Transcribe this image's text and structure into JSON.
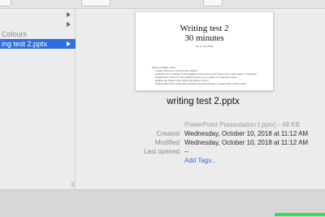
{
  "sidebar": {
    "rows": [
      {
        "label": "",
        "selected": false,
        "has_chevron": true
      },
      {
        "label": "",
        "selected": false,
        "has_chevron": true
      },
      {
        "label": "Colours",
        "selected": false,
        "has_chevron": false
      },
      {
        "label": "ing test 2.pptx",
        "selected": true,
        "has_chevron": true
      }
    ],
    "resize_handle_glyph": "||"
  },
  "preview": {
    "thumbnail": {
      "title_line1": "Writing test 2",
      "title_line2": "30 minutes",
      "date": "10-11 Oct 2018",
      "intro": "When you finish, check:",
      "bullets": [
        "Content: Have you covered all the content?",
        "Grammar and vocabulary: Is the grammar accurate and correct? Does it use a wide range of vocabulary?",
        "Organisation: Is the text well-organised? Does it use a variety of connecting words?",
        "Register and format: Is the format and register correct?",
        "Target reader: Is the reader fully informed? Does the text have a positive effect on the reader?"
      ]
    },
    "file_name": "writing test 2.pptx",
    "kind_size": "PowerPoint Presentation (.pptx) - 48 KB",
    "info": [
      {
        "label": "Created",
        "value": "Wednesday, October 10, 2018 at 11:12 AM"
      },
      {
        "label": "Modified",
        "value": "Wednesday, October 10, 2018 at 11:12 AM"
      },
      {
        "label": "Last opened",
        "value": "--"
      }
    ],
    "add_tags": "Add Tags..."
  },
  "colors": {
    "selection": "#2f6ee0",
    "link": "#2f6ee0",
    "bottom_highlight": "#35e24a"
  }
}
